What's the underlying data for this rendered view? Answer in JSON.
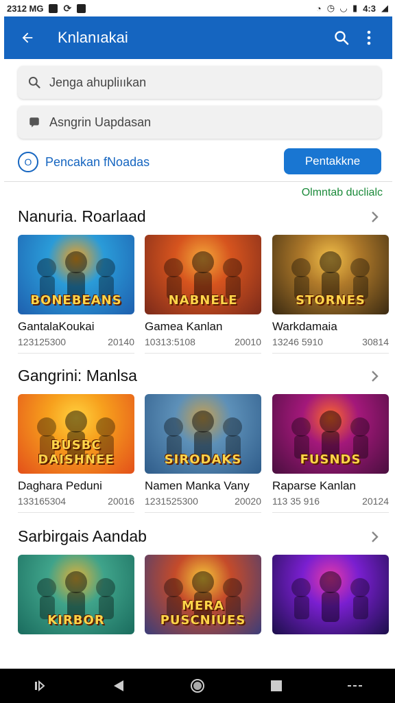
{
  "status_bar": {
    "time": "2312 MG",
    "battery": "4:3"
  },
  "app_bar": {
    "title": "Knlanıakai",
    "back_icon": "arrow-left-icon",
    "search_icon": "search-icon",
    "menu_icon": "more-vert-icon"
  },
  "search": {
    "text": "Jenga ahupliııkan"
  },
  "second_field": {
    "text": "Asngrin Uapdasan"
  },
  "promo": {
    "link_label": "Pencakan fNoadas",
    "link_icon_text": "O",
    "button_label": "Pentakkne"
  },
  "green_link": "Olmntab duclialc",
  "sections": [
    {
      "title": "Nanuria. Roarlaad",
      "cards": [
        {
          "name": "GantalaKoukai",
          "id": "123125300",
          "year": "20140",
          "art_text": "BONEBEANS",
          "palette": [
            "#1e5fae",
            "#2a9bd8",
            "#f2a11f"
          ]
        },
        {
          "name": "Gamea Kanlan",
          "id": "10313:5108",
          "year": "20010",
          "art_text": "NABNELE",
          "palette": [
            "#7b2a1a",
            "#d6541e",
            "#f4a83a"
          ]
        },
        {
          "name": "Warkdamaia",
          "id": "13246 5910",
          "year": "30814",
          "art_text": "STORNES",
          "palette": [
            "#3a2a12",
            "#b07a2a",
            "#f2c04a"
          ]
        }
      ]
    },
    {
      "title": "Gangrini: Manlsa",
      "cards": [
        {
          "name": "Daghara Peduni",
          "id": "133165304",
          "year": "20016",
          "art_text": "BUSBC DAISHNEE",
          "palette": [
            "#e3501a",
            "#f7a01d",
            "#ffd23f"
          ]
        },
        {
          "name": "Namen Manka Vany",
          "id": "1231525300",
          "year": "20020",
          "art_text": "SIRODAKS",
          "palette": [
            "#2f5c8a",
            "#5d90b8",
            "#c7a050"
          ]
        },
        {
          "name": "Raparse Kanlan",
          "id": "113 35 916",
          "year": "20124",
          "art_text": "FUSNDS",
          "palette": [
            "#4a0f3f",
            "#a3187a",
            "#ff6a2a"
          ]
        }
      ]
    },
    {
      "title": "Sarbirgais Aandab",
      "cards": [
        {
          "name": "",
          "id": "",
          "year": "",
          "art_text": "KIRBOR",
          "palette": [
            "#1a6c5e",
            "#3fa38a",
            "#e0b13a"
          ]
        },
        {
          "name": "",
          "id": "",
          "year": "",
          "art_text": "MERA PUSCNIUES",
          "palette": [
            "#3b3d7a",
            "#c54b2a",
            "#f5c83a"
          ]
        },
        {
          "name": "",
          "id": "",
          "year": "",
          "art_text": "",
          "palette": [
            "#1c0f4a",
            "#7a1fd0",
            "#e83aa8"
          ]
        }
      ]
    }
  ],
  "nav_bar": {
    "icons": [
      "recents-icon",
      "back-triangle-icon",
      "home-circle-icon",
      "overview-square-icon",
      "dots-icon"
    ]
  },
  "colors": {
    "primary": "#1565c0",
    "accent_green": "#1b8a3a",
    "button_blue": "#1976d2"
  }
}
